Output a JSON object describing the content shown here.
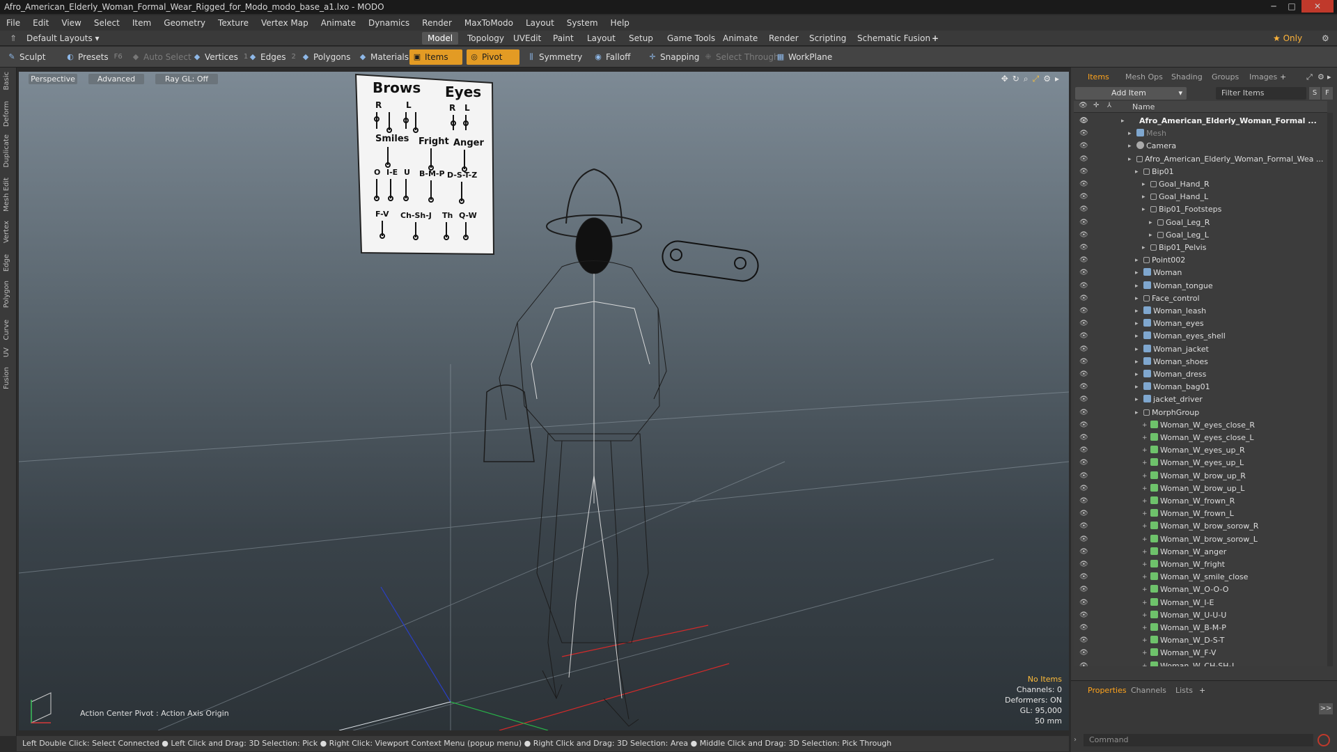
{
  "window": {
    "title": "Afro_American_Elderly_Woman_Formal_Wear_Rigged_for_Modo_modo_base_a1.lxo - MODO",
    "controls": [
      "─",
      "□",
      "✕"
    ]
  },
  "menu": [
    "File",
    "Edit",
    "View",
    "Select",
    "Item",
    "Geometry",
    "Texture",
    "Vertex Map",
    "Animate",
    "Dynamics",
    "Render",
    "MaxToModo",
    "Layout",
    "System",
    "Help"
  ],
  "layout": {
    "selector": "Default Layouts ▾",
    "tabs": [
      "Model",
      "Topology",
      "UVEdit",
      "Paint",
      "Layout",
      "Setup",
      "Game Tools",
      "Animate",
      "Render",
      "Scripting",
      "Schematic Fusion"
    ],
    "active": "Model",
    "add": "+",
    "only": "★  Only"
  },
  "toolbar": {
    "sculpt": "Sculpt",
    "presets": "Presets",
    "presets_key": "F6",
    "auto_select": "Auto Select",
    "vertices": "Vertices",
    "vertices_key": "1",
    "edges": "Edges",
    "edges_key": "2",
    "polygons": "Polygons",
    "materials": "Materials",
    "items": "Items",
    "pivot": "Pivot",
    "symmetry": "Symmetry",
    "falloff": "Falloff",
    "snapping": "Snapping",
    "select_through": "Select Through",
    "workplane": "WorkPlane"
  },
  "left_tabs": [
    "Basic",
    "Deform",
    "Duplicate",
    "Mesh Edit",
    "Vertex",
    "Edge",
    "Polygon",
    "Curve",
    "UV",
    "Fusion"
  ],
  "viewport": {
    "view": "Perspective",
    "shading": "Advanced",
    "raygl": "Ray GL: Off",
    "action_center": "Action Center Pivot : Action Axis Origin",
    "info": {
      "no_items": "No Items",
      "channels": "Channels: 0",
      "deformers": "Deformers: ON",
      "gl": "GL: 95,000",
      "lens": "50 mm"
    },
    "chart": {
      "brows": "Brows",
      "eyes": "Eyes",
      "r": "R",
      "l": "L",
      "smiles": "Smiles",
      "fright": "Fright",
      "anger": "Anger",
      "o": "O",
      "ie": "I-E",
      "u": "U",
      "bmp": "B-M-P",
      "dstz": "D-S-T-Z",
      "fv": "F-V",
      "chshj": "Ch-Sh-J",
      "th": "Th",
      "qw": "Q-W"
    }
  },
  "status": "Left Double Click: Select Connected ● Left Click and Drag: 3D Selection: Pick ● Right Click: Viewport Context Menu (popup menu) ● Right Click and Drag: 3D Selection: Area ● Middle Click and Drag: 3D Selection: Pick Through",
  "panel": {
    "tabs": [
      "Items",
      "Mesh Ops",
      "Shading",
      "Groups",
      "Images"
    ],
    "active": "Items",
    "add_item": "Add Item",
    "filter": "Filter Items",
    "s": "S",
    "f": "F",
    "name_col": "Name",
    "items": [
      {
        "label": "Afro_American_Elderly_Woman_Formal ...",
        "indent": 0,
        "type": "scene",
        "style": "bold"
      },
      {
        "label": "Mesh",
        "indent": 1,
        "type": "mesh",
        "style": "grey"
      },
      {
        "label": "Camera",
        "indent": 1,
        "type": "cam",
        "style": ""
      },
      {
        "label": "Afro_American_Elderly_Woman_Formal_Wea ...",
        "indent": 1,
        "type": "bone",
        "style": ""
      },
      {
        "label": "Bip01",
        "indent": 2,
        "type": "bone",
        "style": ""
      },
      {
        "label": "Goal_Hand_R",
        "indent": 3,
        "type": "bone",
        "style": ""
      },
      {
        "label": "Goal_Hand_L",
        "indent": 3,
        "type": "bone",
        "style": ""
      },
      {
        "label": "Bip01_Footsteps",
        "indent": 3,
        "type": "bone",
        "style": ""
      },
      {
        "label": "Goal_Leg_R",
        "indent": 4,
        "type": "bone",
        "style": ""
      },
      {
        "label": "Goal_Leg_L",
        "indent": 4,
        "type": "bone",
        "style": ""
      },
      {
        "label": "Bip01_Pelvis",
        "indent": 3,
        "type": "bone",
        "style": ""
      },
      {
        "label": "Point002",
        "indent": 2,
        "type": "bone",
        "style": ""
      },
      {
        "label": "Woman",
        "indent": 2,
        "type": "mesh",
        "style": ""
      },
      {
        "label": "Woman_tongue",
        "indent": 2,
        "type": "mesh",
        "style": ""
      },
      {
        "label": "Face_control",
        "indent": 2,
        "type": "bone",
        "style": ""
      },
      {
        "label": "Woman_leash",
        "indent": 2,
        "type": "mesh",
        "style": ""
      },
      {
        "label": "Woman_eyes",
        "indent": 2,
        "type": "mesh",
        "style": ""
      },
      {
        "label": "Woman_eyes_shell",
        "indent": 2,
        "type": "mesh",
        "style": ""
      },
      {
        "label": "Woman_jacket",
        "indent": 2,
        "type": "mesh",
        "style": ""
      },
      {
        "label": "Woman_shoes",
        "indent": 2,
        "type": "mesh",
        "style": ""
      },
      {
        "label": "Woman_dress",
        "indent": 2,
        "type": "mesh",
        "style": ""
      },
      {
        "label": "Woman_bag01",
        "indent": 2,
        "type": "mesh",
        "style": ""
      },
      {
        "label": "jacket_driver",
        "indent": 2,
        "type": "mesh",
        "style": ""
      },
      {
        "label": "MorphGroup",
        "indent": 2,
        "type": "bone",
        "style": ""
      },
      {
        "label": "Woman_W_eyes_close_R",
        "indent": 3,
        "type": "morph",
        "style": ""
      },
      {
        "label": "Woman_W_eyes_close_L",
        "indent": 3,
        "type": "morph",
        "style": ""
      },
      {
        "label": "Woman_W_eyes_up_R",
        "indent": 3,
        "type": "morph",
        "style": ""
      },
      {
        "label": "Woman_W_eyes_up_L",
        "indent": 3,
        "type": "morph",
        "style": ""
      },
      {
        "label": "Woman_W_brow_up_R",
        "indent": 3,
        "type": "morph",
        "style": ""
      },
      {
        "label": "Woman_W_brow_up_L",
        "indent": 3,
        "type": "morph",
        "style": ""
      },
      {
        "label": "Woman_W_frown_R",
        "indent": 3,
        "type": "morph",
        "style": ""
      },
      {
        "label": "Woman_W_frown_L",
        "indent": 3,
        "type": "morph",
        "style": ""
      },
      {
        "label": "Woman_W_brow_sorow_R",
        "indent": 3,
        "type": "morph",
        "style": ""
      },
      {
        "label": "Woman_W_brow_sorow_L",
        "indent": 3,
        "type": "morph",
        "style": ""
      },
      {
        "label": "Woman_W_anger",
        "indent": 3,
        "type": "morph",
        "style": ""
      },
      {
        "label": "Woman_W_fright",
        "indent": 3,
        "type": "morph",
        "style": ""
      },
      {
        "label": "Woman_W_smile_close",
        "indent": 3,
        "type": "morph",
        "style": ""
      },
      {
        "label": "Woman_W_O-O-O",
        "indent": 3,
        "type": "morph",
        "style": ""
      },
      {
        "label": "Woman_W_I-E",
        "indent": 3,
        "type": "morph",
        "style": ""
      },
      {
        "label": "Woman_W_U-U-U",
        "indent": 3,
        "type": "morph",
        "style": ""
      },
      {
        "label": "Woman_W_B-M-P",
        "indent": 3,
        "type": "morph",
        "style": ""
      },
      {
        "label": "Woman_W_D-S-T",
        "indent": 3,
        "type": "morph",
        "style": ""
      },
      {
        "label": "Woman_W_F-V",
        "indent": 3,
        "type": "morph",
        "style": ""
      },
      {
        "label": "Woman_W_CH-SH-J",
        "indent": 3,
        "type": "morph",
        "style": ""
      }
    ]
  },
  "bottom_panel": {
    "tabs": [
      "Properties",
      "Channels",
      "Lists"
    ],
    "active": "Properties",
    "add": "+",
    "command_placeholder": "Command",
    "expand": ">>"
  }
}
